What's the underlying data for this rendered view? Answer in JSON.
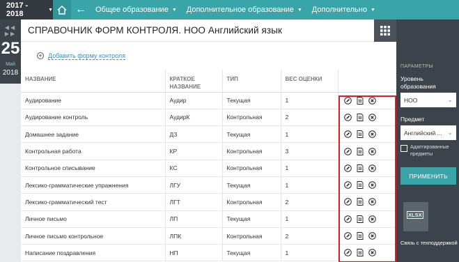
{
  "topbar": {
    "year": "2017 - 2018",
    "nav": [
      {
        "label": "Общее образование"
      },
      {
        "label": "Дополнительное образование"
      },
      {
        "label": "Дополнительно"
      }
    ]
  },
  "date": {
    "day": "25",
    "month": "Май",
    "year": "2018"
  },
  "page": {
    "title": "СПРАВОЧНИК ФОРМ КОНТРОЛЯ. НОО Английский язык",
    "add_link": "Добавить форму контроля"
  },
  "table": {
    "headers": [
      "НАЗВАНИЕ",
      "КРАТКОЕ НАЗВАНИЕ",
      "ТИП",
      "ВЕС ОЦЕНКИ"
    ],
    "rows": [
      [
        "Аудирование",
        "Аудир",
        "Текущая",
        "1"
      ],
      [
        "Аудирование контроль",
        "АудирК",
        "Контрольная",
        "2"
      ],
      [
        "Домашнее задание",
        "ДЗ",
        "Текущая",
        "1"
      ],
      [
        "Контрольная работа",
        "КР",
        "Контрольная",
        "3"
      ],
      [
        "Контрольное списывание",
        "КС",
        "Контрольная",
        "1"
      ],
      [
        "Лексико-грамматические упражнения",
        "ЛГУ",
        "Текущая",
        "1"
      ],
      [
        "Лексико-грамматический тест",
        "ЛГТ",
        "Контрольная",
        "2"
      ],
      [
        "Личное письмо",
        "ЛП",
        "Текущая",
        "1"
      ],
      [
        "Личное письмо контрольное",
        "ЛПК",
        "Контрольная",
        "2"
      ],
      [
        "Написание поздравления",
        "НП",
        "Текущая",
        "1"
      ]
    ]
  },
  "sidebar": {
    "params_title": "ПАРАМЕТРЫ",
    "level_label": "Уровень образования",
    "level_value": "НОО",
    "subject_label": "Предмет",
    "subject_value": "Английский ...",
    "adapted_label": "Адаптированные предметы",
    "apply": "ПРИМЕНИТЬ",
    "xlsx": "XLSX",
    "support": "Связь с техподдержкой"
  },
  "colors": {
    "accent": "#3aa5a9",
    "dark": "#3d434a",
    "highlight": "#d8202a"
  }
}
